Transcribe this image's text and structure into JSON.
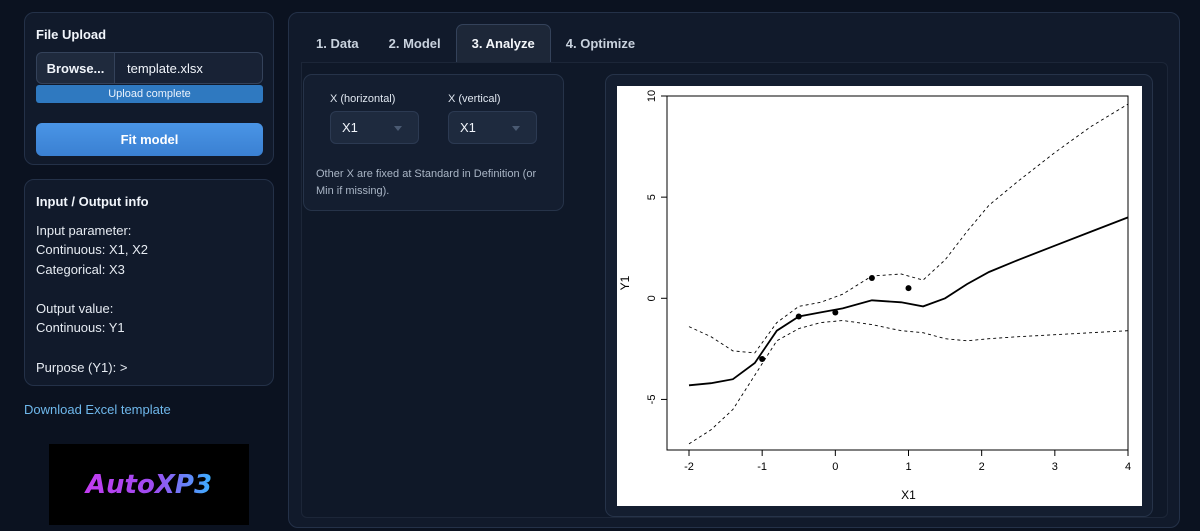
{
  "upload": {
    "title": "File Upload",
    "browse_label": "Browse...",
    "file_name": "template.xlsx",
    "progress_text": "Upload complete",
    "progress": 1.0,
    "fit_label": "Fit model"
  },
  "io": {
    "title": "Input / Output info",
    "input_header": "Input parameter:",
    "continuous_inputs": "Continuous: X1, X2",
    "categorical_inputs": "Categorical: X3",
    "output_header": "Output value:",
    "continuous_outputs": "Continuous: Y1",
    "purpose": "Purpose (Y1): >"
  },
  "download_label": "Download Excel template",
  "logo": {
    "text_a": "Auto",
    "text_b": "XP3"
  },
  "tabs": [
    {
      "label": "1. Data",
      "active": false
    },
    {
      "label": "2. Model",
      "active": false
    },
    {
      "label": "3. Analyze",
      "active": true
    },
    {
      "label": "4. Optimize",
      "active": false
    }
  ],
  "settings": {
    "x_horizontal_label": "X (horizontal)",
    "x_horizontal_value": "X1",
    "x_vertical_label": "X (vertical)",
    "x_vertical_value": "X1",
    "note": "Other X are fixed at Standard in Definition (or Min if missing)."
  },
  "colors": {
    "accent": "#3a80d2",
    "progress": "#2f79c0",
    "link": "#6fb8ec",
    "logo_magenta": "#c33cf0",
    "logo_cyan": "#3ab0ff"
  },
  "chart_data": {
    "type": "line",
    "xlabel": "X1",
    "ylabel": "Y1",
    "xlim": [
      -2,
      4
    ],
    "ylim": [
      -7.5,
      10
    ],
    "xticks": [
      -2,
      -1,
      0,
      1,
      2,
      3,
      4
    ],
    "yticks": [
      -5,
      0,
      5,
      10
    ],
    "grid": false,
    "series": [
      {
        "style": "solid",
        "x": [
          -2,
          -1.7,
          -1.4,
          -1.1,
          -0.8,
          -0.5,
          -0.2,
          0.1,
          0.5,
          0.9,
          1.2,
          1.5,
          1.8,
          2.1,
          2.5,
          3.0,
          3.5,
          4.0
        ],
        "y": [
          -4.3,
          -4.2,
          -4.0,
          -3.2,
          -1.6,
          -0.9,
          -0.7,
          -0.5,
          -0.1,
          -0.2,
          -0.4,
          0.0,
          0.7,
          1.3,
          1.9,
          2.6,
          3.3,
          4.0
        ]
      },
      {
        "style": "dashed",
        "x": [
          -2,
          -1.7,
          -1.4,
          -1.1,
          -0.8,
          -0.5,
          -0.2,
          0.1,
          0.5,
          0.9,
          1.2,
          1.5,
          1.8,
          2.1,
          2.5,
          3.0,
          3.5,
          4.0
        ],
        "y": [
          -1.4,
          -1.9,
          -2.6,
          -2.7,
          -1.2,
          -0.4,
          -0.2,
          0.2,
          1.1,
          1.2,
          0.9,
          1.9,
          3.3,
          4.6,
          5.8,
          7.2,
          8.5,
          9.6
        ]
      },
      {
        "style": "dashed",
        "x": [
          -2,
          -1.7,
          -1.4,
          -1.1,
          -0.8,
          -0.5,
          -0.2,
          0.1,
          0.5,
          0.9,
          1.2,
          1.5,
          1.8,
          2.1,
          2.5,
          3.0,
          3.5,
          4.0
        ],
        "y": [
          -7.2,
          -6.5,
          -5.5,
          -3.8,
          -2.1,
          -1.5,
          -1.2,
          -1.1,
          -1.3,
          -1.6,
          -1.7,
          -2.0,
          -2.1,
          -2.0,
          -1.9,
          -1.8,
          -1.7,
          -1.6
        ]
      }
    ],
    "points": {
      "x": [
        -1.0,
        -0.5,
        0.0,
        0.5,
        1.0
      ],
      "y": [
        -3.0,
        -0.9,
        -0.7,
        1.0,
        0.5
      ]
    }
  }
}
